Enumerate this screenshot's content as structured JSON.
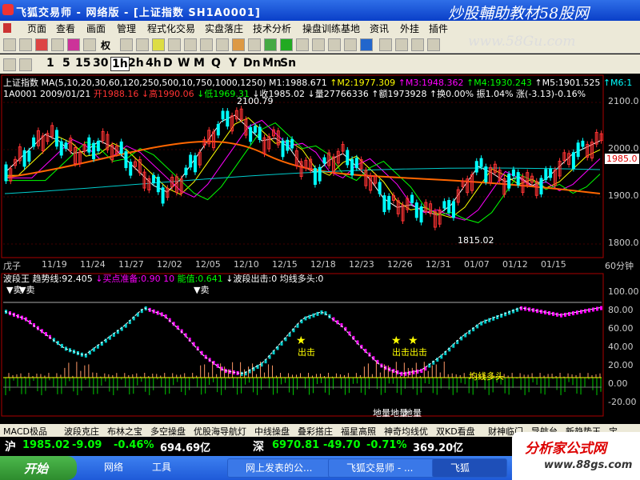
{
  "window": {
    "title": "飞狐交易师 - 网络版 - [上证指数 SH1A0001]"
  },
  "watermark": {
    "brand": "炒股輔助教材58股网",
    "url": "www.58Gu.com",
    "footer_brand": "分析家公式网",
    "footer_url": "www.88gs.com"
  },
  "menu": [
    "页面",
    "查看",
    "画面",
    "管理",
    "程式化交易",
    "实盘落庄",
    "技术分析",
    "操盘训练基地",
    "资讯",
    "外挂",
    "插件"
  ],
  "toolbar": {
    "right_label": "权",
    "periods": [
      "1",
      "5",
      "15",
      "30",
      "1h",
      "2h",
      "4h",
      "D",
      "W",
      "M",
      "Q",
      "Y",
      "Dn",
      "Mn",
      "Sn"
    ]
  },
  "price_panel": {
    "title": "上证指数",
    "ma_label": "MA(5,10,20,30,60,120,250,500,10,750,1000,1250)",
    "ma_values": [
      {
        "text": "M1:1988.671",
        "color": "#ffffff"
      },
      {
        "text": "↑M2:1977.309",
        "color": "#ffff00"
      },
      {
        "text": "↑M3:1948.362",
        "color": "#ff00ff"
      },
      {
        "text": "↑M4:1930.243",
        "color": "#00ff00"
      },
      {
        "text": "↑M5:1901.525",
        "color": "#ffffff"
      },
      {
        "text": "↑M6:1",
        "color": "#00ffff"
      }
    ],
    "quote": [
      {
        "text": "1A0001",
        "color": "#ffffff"
      },
      {
        "text": "2009/01/21",
        "color": "#ffffff"
      },
      {
        "text": "开1988.16",
        "color": "#ff3333"
      },
      {
        "text": "↓高1990.06",
        "color": "#ff3333"
      },
      {
        "text": "↓低1969.31",
        "color": "#00ff00"
      },
      {
        "text": "↓收1985.02",
        "color": "#ffffff"
      },
      {
        "text": "↓量27766336",
        "color": "#ffffff"
      },
      {
        "text": "↑额1973928",
        "color": "#ffffff"
      },
      {
        "text": "↑换0.00%",
        "color": "#ffffff"
      },
      {
        "text": "振1.04%",
        "color": "#ffffff"
      },
      {
        "text": "涨(-3.13)-0.16%",
        "color": "#ffffff"
      }
    ],
    "y_ticks": [
      "2100.0",
      "2000.0",
      "1900.0",
      "1800.0"
    ],
    "high_label": "2100.79",
    "low_label": "1815.02",
    "last_price": "1985.0"
  },
  "date_axis": {
    "label": "戊子",
    "dates": [
      "11/19",
      "11/24",
      "11/27",
      "12/02",
      "12/05",
      "12/10",
      "12/15",
      "12/18",
      "12/23",
      "12/26",
      "12/31",
      "01/07",
      "01/12",
      "01/15"
    ],
    "period": "60分钟"
  },
  "indicator_panel": {
    "title": "波段王",
    "values": [
      {
        "text": "趋势线:92.405",
        "color": "#ffffff"
      },
      {
        "text": "↓买点准备:0.90 10",
        "color": "#ff00ff"
      },
      {
        "text": "能值:0.641",
        "color": "#00ff00"
      },
      {
        "text": "↓波段出击:0",
        "color": "#ffffff"
      },
      {
        "text": "均线多头:0",
        "color": "#ffffff"
      }
    ],
    "y_ticks": [
      "100.00",
      "80.00",
      "60.00",
      "40.00",
      "20.00",
      "0.00",
      "-20.00"
    ],
    "sell_label": "卖",
    "attack_label": "出击",
    "bull_label": "均线多头",
    "bottom_label": "地量",
    "bottom_label2": "地量地量"
  },
  "tabs": [
    "MACD极品",
    "波段克庄",
    "布林之宝",
    "多空操盘",
    "优股海导航灯",
    "中线操盘",
    "叠彩搭庄",
    "福星高照",
    "神奇均线优",
    "双KD看盘",
    "财神临门",
    "导航台",
    "新趋势王",
    "宝"
  ],
  "status": {
    "sh_label": "沪",
    "sh_value": "1985.02",
    "sh_change": "-9.09",
    "sh_pct": "-0.46%",
    "sh_amount": "694.69亿",
    "sz_label": "深",
    "sz_value": "6970.81",
    "sz_change": "-49.70",
    "sz_pct": "-0.71%",
    "sz_amount": "369.20亿"
  },
  "taskbar": {
    "start": "开始",
    "items": [
      "网络",
      "工具",
      "",
      "网上发表的公...",
      "飞狐交易师 - ...",
      "飞狐"
    ]
  }
}
